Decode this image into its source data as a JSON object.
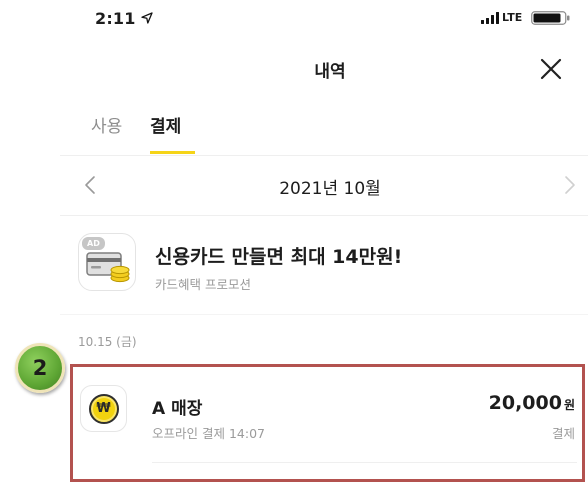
{
  "status_bar": {
    "time": "2:11",
    "network": "LTE",
    "location_icon": "location-arrow-icon",
    "signal_icon": "signal-bars-icon",
    "battery_icon": "battery-icon"
  },
  "header": {
    "title": "내역",
    "close_icon": "close-icon"
  },
  "tabs": [
    {
      "label": "사용",
      "active": false
    },
    {
      "label": "결제",
      "active": true
    }
  ],
  "month_nav": {
    "label": "2021년 10월",
    "prev_icon": "chevron-left-icon",
    "next_icon": "chevron-right-icon"
  },
  "promo": {
    "badge": "AD",
    "title": "신용카드 만들면 최대 14만원!",
    "subtitle": "카드혜택 프로모션",
    "icon": "credit-card-coins-icon"
  },
  "history": {
    "date": "10.15 (금)",
    "items": [
      {
        "icon": "won-coin-icon",
        "icon_symbol": "₩",
        "merchant": "A 매장",
        "detail": "오프라인 결제 14:07",
        "amount": "20,000",
        "currency": "원",
        "type": "결제"
      }
    ]
  },
  "annotation": {
    "step_number": "2"
  },
  "colors": {
    "accent_yellow": "#f5d418",
    "text_primary": "#1d1d1d",
    "text_secondary": "#9b9b9b",
    "text_tab_inactive": "#8e8e8e",
    "divider": "#efefef",
    "highlight_border": "#b3524f",
    "step_badge": "#5ea634"
  }
}
